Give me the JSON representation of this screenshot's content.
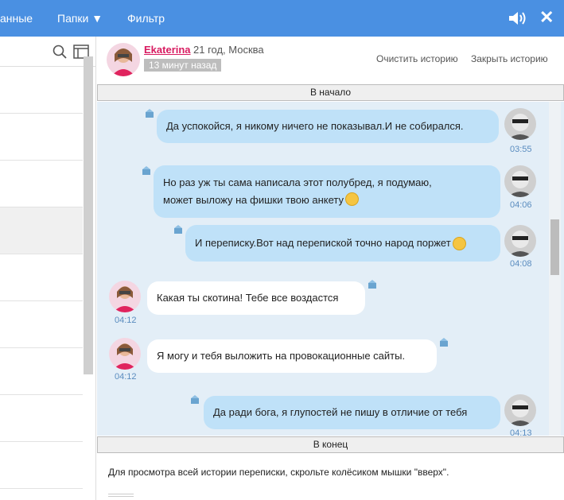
{
  "topbar": {
    "nav_items": [
      {
        "label": "анные"
      },
      {
        "label": "Папки ▼"
      },
      {
        "label": "Фильтр"
      }
    ],
    "sound_icon": "speaker-icon",
    "close_label": "✕"
  },
  "sidebar": {
    "search_icon": "search-icon",
    "panel_icon": "panel-icon"
  },
  "profile": {
    "name": "Ekaterina",
    "age_city": "21 год, Москва",
    "last_seen": "13 минут назад",
    "clear_history": "Очистить историю",
    "close_history": "Закрыть историю"
  },
  "history": {
    "to_start": "В начало",
    "to_end": "В конец",
    "hint": "Для просмотра всей истории переписки, скрольте колёсиком мышки \"вверх\"."
  },
  "messages": [
    {
      "side": "right",
      "text": "Да успокойся, я никому ничего не показывал.И не собирался.",
      "time": "03:55"
    },
    {
      "side": "right",
      "text": "Но раз уж ты сама написала этот полубред, я подумаю,",
      "text2": "может выложу на фишки твою анкету",
      "time": "04:06",
      "emoji": true
    },
    {
      "side": "right",
      "text": "И переписку.Вот над перепиской точно народ поржет",
      "time": "04:08",
      "emoji": true
    },
    {
      "side": "left",
      "text": "Какая ты скотина! Тебе все воздастся",
      "time": "04:12"
    },
    {
      "side": "left",
      "text": "Я могу и тебя выложить на провокационные сайты.",
      "time": "04:12"
    },
    {
      "side": "right",
      "text": "Да ради бога, я глупостей не пишу в отличие от тебя",
      "time": "04:13"
    }
  ],
  "colors": {
    "topbar": "#4a90e2",
    "bubble_out": "#bfe1f8",
    "bubble_in": "#ffffff",
    "chat_bg": "#e3eef7",
    "name": "#d81b60"
  }
}
